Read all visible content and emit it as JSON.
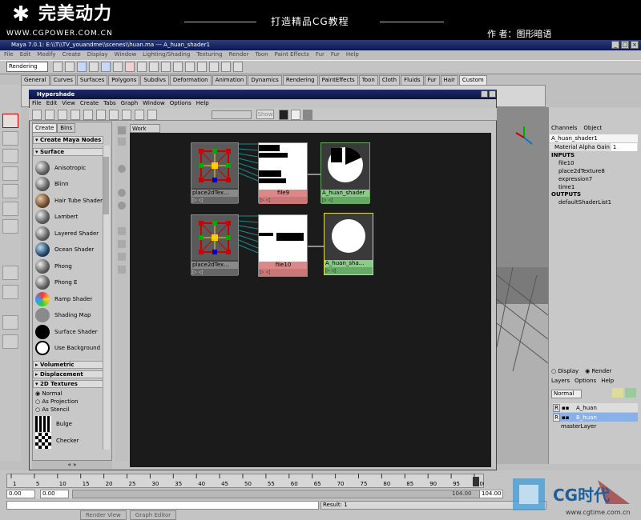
{
  "header": {
    "logo_star": "✱",
    "logo_text": "完美动力",
    "logo_url": "WWW.CGPOWER.COM.CN",
    "title": "打造精品CG教程",
    "author": "作 者：图形暗语"
  },
  "window": {
    "title": "Maya 7.0.1: E:\\\\T\\\\TV_youandme\\\\scenes\\\\huan.ma  ---  A_huan_shader1"
  },
  "menu": [
    "File",
    "Edit",
    "Modify",
    "Create",
    "Display",
    "Window",
    "Lighting/Shading",
    "Texturing",
    "Render",
    "Toon",
    "Paint Effects",
    "Fur",
    "Fur",
    "Help"
  ],
  "toolbar": {
    "mode": "Rendering"
  },
  "shelf_tabs": [
    "General",
    "Curves",
    "Surfaces",
    "Polygons",
    "Subdivs",
    "Deformation",
    "Animation",
    "Dynamics",
    "Rendering",
    "PaintEffects",
    "Toon",
    "Cloth",
    "Fluids",
    "Fur",
    "Hair",
    "Custom"
  ],
  "shelf_active": "Custom",
  "hypershade": {
    "title": "Hypershade",
    "menu": [
      "File",
      "Edit",
      "View",
      "Create",
      "Tabs",
      "Graph",
      "Window",
      "Options",
      "Help"
    ],
    "show_button": "Show",
    "work_area_tab": "Work Area",
    "left_tabs": [
      "Create",
      "Bins"
    ],
    "create_header": "Create Maya Nodes",
    "sections": {
      "surface": "Surface",
      "volumetric": "Volumetric",
      "displacement": "Displacement",
      "textures2d": "2D Textures"
    },
    "surface_nodes": [
      "Anisotropic",
      "Blinn",
      "Hair Tube Shader",
      "Lambert",
      "Layered Shader",
      "Ocean Shader",
      "Phong",
      "Phong E",
      "Ramp Shader",
      "Shading Map",
      "Surface Shader",
      "Use Background"
    ],
    "texture_modes": [
      "Normal",
      "As Projection",
      "As Stencil"
    ],
    "texture_nodes": [
      "Bulge",
      "Checker"
    ],
    "graph_nodes": {
      "row1": {
        "place": "place2dTex...",
        "file": "file9",
        "shader": "A_huan_shader"
      },
      "row2": {
        "place": "place2dTex...",
        "file": "file10",
        "shader": "A_huan_sha..."
      }
    }
  },
  "channel_box": {
    "tabs": [
      "Channels",
      "Object"
    ],
    "object": "A_huan_shader1",
    "attr_name": "Material Alpha Gain",
    "attr_value": "1",
    "inputs_label": "INPUTS",
    "inputs": [
      "file10",
      "place2dTexture8",
      "expression7",
      "time1"
    ],
    "outputs_label": "OUTPUTS",
    "outputs": [
      "defaultShaderList1"
    ]
  },
  "layer_editor": {
    "display_label": "Display",
    "render_label": "Render",
    "menu": [
      "Layers",
      "Options",
      "Help"
    ],
    "blend": "Normal",
    "layers": [
      {
        "flag": "R",
        "name": "A_huan"
      },
      {
        "flag": "R",
        "name": "B_huan"
      }
    ],
    "master": "masterLayer"
  },
  "timeline": {
    "ticks": [
      "1",
      "5",
      "10",
      "15",
      "20",
      "25",
      "30",
      "35",
      "40",
      "45",
      "50",
      "55",
      "60",
      "65",
      "70",
      "75",
      "80",
      "85",
      "90",
      "95",
      "100"
    ],
    "start": "0.00",
    "start2": "0.00",
    "end": "104.00",
    "end_partial": "104.00"
  },
  "result": "Result: 1",
  "taskbar": [
    "Render View",
    "Graph Editor"
  ],
  "watermark": {
    "brand": "CG时代",
    "url": "www.cgtime.com.cn"
  }
}
